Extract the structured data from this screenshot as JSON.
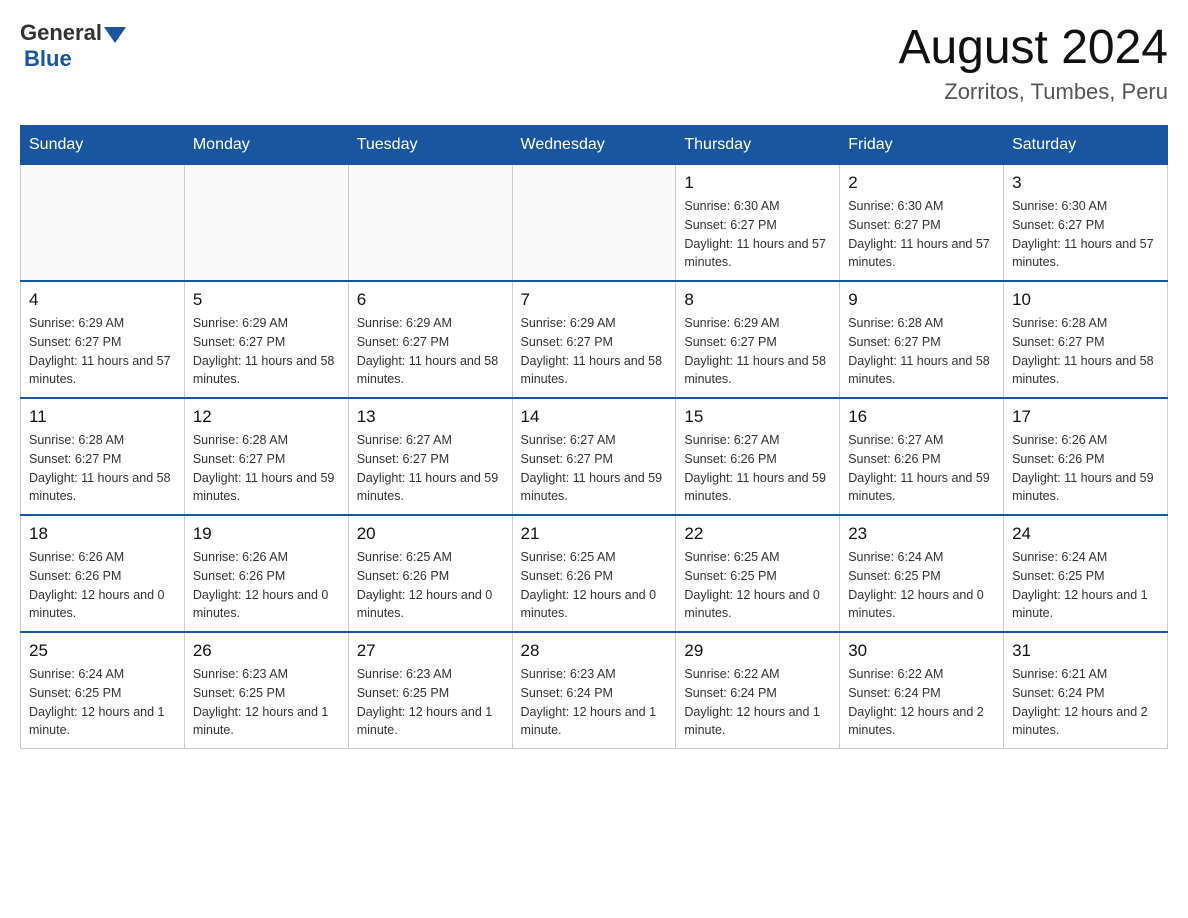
{
  "logo": {
    "general": "General",
    "blue": "Blue"
  },
  "title": "August 2024",
  "location": "Zorritos, Tumbes, Peru",
  "days_of_week": [
    "Sunday",
    "Monday",
    "Tuesday",
    "Wednesday",
    "Thursday",
    "Friday",
    "Saturday"
  ],
  "weeks": [
    [
      {
        "day": "",
        "sunrise": "",
        "sunset": "",
        "daylight": ""
      },
      {
        "day": "",
        "sunrise": "",
        "sunset": "",
        "daylight": ""
      },
      {
        "day": "",
        "sunrise": "",
        "sunset": "",
        "daylight": ""
      },
      {
        "day": "",
        "sunrise": "",
        "sunset": "",
        "daylight": ""
      },
      {
        "day": "1",
        "sunrise": "Sunrise: 6:30 AM",
        "sunset": "Sunset: 6:27 PM",
        "daylight": "Daylight: 11 hours and 57 minutes."
      },
      {
        "day": "2",
        "sunrise": "Sunrise: 6:30 AM",
        "sunset": "Sunset: 6:27 PM",
        "daylight": "Daylight: 11 hours and 57 minutes."
      },
      {
        "day": "3",
        "sunrise": "Sunrise: 6:30 AM",
        "sunset": "Sunset: 6:27 PM",
        "daylight": "Daylight: 11 hours and 57 minutes."
      }
    ],
    [
      {
        "day": "4",
        "sunrise": "Sunrise: 6:29 AM",
        "sunset": "Sunset: 6:27 PM",
        "daylight": "Daylight: 11 hours and 57 minutes."
      },
      {
        "day": "5",
        "sunrise": "Sunrise: 6:29 AM",
        "sunset": "Sunset: 6:27 PM",
        "daylight": "Daylight: 11 hours and 58 minutes."
      },
      {
        "day": "6",
        "sunrise": "Sunrise: 6:29 AM",
        "sunset": "Sunset: 6:27 PM",
        "daylight": "Daylight: 11 hours and 58 minutes."
      },
      {
        "day": "7",
        "sunrise": "Sunrise: 6:29 AM",
        "sunset": "Sunset: 6:27 PM",
        "daylight": "Daylight: 11 hours and 58 minutes."
      },
      {
        "day": "8",
        "sunrise": "Sunrise: 6:29 AM",
        "sunset": "Sunset: 6:27 PM",
        "daylight": "Daylight: 11 hours and 58 minutes."
      },
      {
        "day": "9",
        "sunrise": "Sunrise: 6:28 AM",
        "sunset": "Sunset: 6:27 PM",
        "daylight": "Daylight: 11 hours and 58 minutes."
      },
      {
        "day": "10",
        "sunrise": "Sunrise: 6:28 AM",
        "sunset": "Sunset: 6:27 PM",
        "daylight": "Daylight: 11 hours and 58 minutes."
      }
    ],
    [
      {
        "day": "11",
        "sunrise": "Sunrise: 6:28 AM",
        "sunset": "Sunset: 6:27 PM",
        "daylight": "Daylight: 11 hours and 58 minutes."
      },
      {
        "day": "12",
        "sunrise": "Sunrise: 6:28 AM",
        "sunset": "Sunset: 6:27 PM",
        "daylight": "Daylight: 11 hours and 59 minutes."
      },
      {
        "day": "13",
        "sunrise": "Sunrise: 6:27 AM",
        "sunset": "Sunset: 6:27 PM",
        "daylight": "Daylight: 11 hours and 59 minutes."
      },
      {
        "day": "14",
        "sunrise": "Sunrise: 6:27 AM",
        "sunset": "Sunset: 6:27 PM",
        "daylight": "Daylight: 11 hours and 59 minutes."
      },
      {
        "day": "15",
        "sunrise": "Sunrise: 6:27 AM",
        "sunset": "Sunset: 6:26 PM",
        "daylight": "Daylight: 11 hours and 59 minutes."
      },
      {
        "day": "16",
        "sunrise": "Sunrise: 6:27 AM",
        "sunset": "Sunset: 6:26 PM",
        "daylight": "Daylight: 11 hours and 59 minutes."
      },
      {
        "day": "17",
        "sunrise": "Sunrise: 6:26 AM",
        "sunset": "Sunset: 6:26 PM",
        "daylight": "Daylight: 11 hours and 59 minutes."
      }
    ],
    [
      {
        "day": "18",
        "sunrise": "Sunrise: 6:26 AM",
        "sunset": "Sunset: 6:26 PM",
        "daylight": "Daylight: 12 hours and 0 minutes."
      },
      {
        "day": "19",
        "sunrise": "Sunrise: 6:26 AM",
        "sunset": "Sunset: 6:26 PM",
        "daylight": "Daylight: 12 hours and 0 minutes."
      },
      {
        "day": "20",
        "sunrise": "Sunrise: 6:25 AM",
        "sunset": "Sunset: 6:26 PM",
        "daylight": "Daylight: 12 hours and 0 minutes."
      },
      {
        "day": "21",
        "sunrise": "Sunrise: 6:25 AM",
        "sunset": "Sunset: 6:26 PM",
        "daylight": "Daylight: 12 hours and 0 minutes."
      },
      {
        "day": "22",
        "sunrise": "Sunrise: 6:25 AM",
        "sunset": "Sunset: 6:25 PM",
        "daylight": "Daylight: 12 hours and 0 minutes."
      },
      {
        "day": "23",
        "sunrise": "Sunrise: 6:24 AM",
        "sunset": "Sunset: 6:25 PM",
        "daylight": "Daylight: 12 hours and 0 minutes."
      },
      {
        "day": "24",
        "sunrise": "Sunrise: 6:24 AM",
        "sunset": "Sunset: 6:25 PM",
        "daylight": "Daylight: 12 hours and 1 minute."
      }
    ],
    [
      {
        "day": "25",
        "sunrise": "Sunrise: 6:24 AM",
        "sunset": "Sunset: 6:25 PM",
        "daylight": "Daylight: 12 hours and 1 minute."
      },
      {
        "day": "26",
        "sunrise": "Sunrise: 6:23 AM",
        "sunset": "Sunset: 6:25 PM",
        "daylight": "Daylight: 12 hours and 1 minute."
      },
      {
        "day": "27",
        "sunrise": "Sunrise: 6:23 AM",
        "sunset": "Sunset: 6:25 PM",
        "daylight": "Daylight: 12 hours and 1 minute."
      },
      {
        "day": "28",
        "sunrise": "Sunrise: 6:23 AM",
        "sunset": "Sunset: 6:24 PM",
        "daylight": "Daylight: 12 hours and 1 minute."
      },
      {
        "day": "29",
        "sunrise": "Sunrise: 6:22 AM",
        "sunset": "Sunset: 6:24 PM",
        "daylight": "Daylight: 12 hours and 1 minute."
      },
      {
        "day": "30",
        "sunrise": "Sunrise: 6:22 AM",
        "sunset": "Sunset: 6:24 PM",
        "daylight": "Daylight: 12 hours and 2 minutes."
      },
      {
        "day": "31",
        "sunrise": "Sunrise: 6:21 AM",
        "sunset": "Sunset: 6:24 PM",
        "daylight": "Daylight: 12 hours and 2 minutes."
      }
    ]
  ]
}
